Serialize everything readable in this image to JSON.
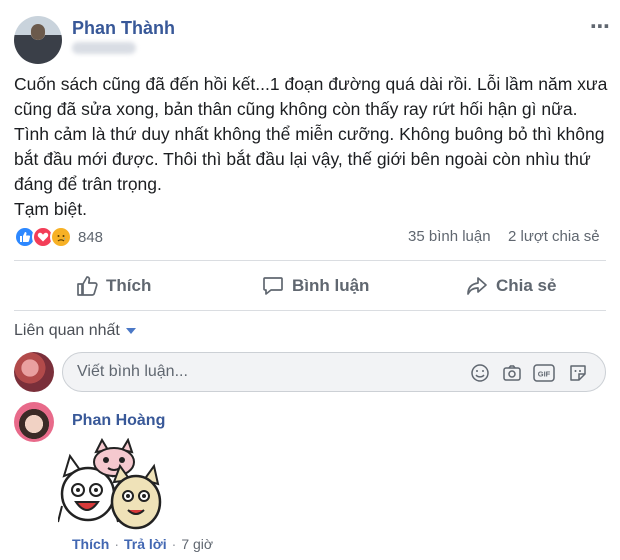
{
  "post": {
    "author": "Phan Thành",
    "text": "Cuốn sách cũng đã đến hồi kết...1 đoạn đường quá dài rồi. Lỗi lầm năm xưa cũng đã sửa xong, bản thân cũng không còn thấy ray rứt hối hận gì nữa. Tình cảm là thứ duy nhất không thể miễn cưỡng. Không buông bỏ thì không bắt đầu mới được. Thôi thì bắt đầu lại vậy, thế giới bên ngoài còn nhìu thứ đáng để trân trọng.\nTạm biệt.",
    "reaction_count": "848",
    "comments_count": "35 bình luận",
    "shares_count": "2 lượt chia sẻ",
    "reactions": [
      "like-icon",
      "love-icon",
      "sad-icon"
    ],
    "colors": {
      "link": "#385898",
      "like": "#2d88ff",
      "love": "#f33e58",
      "sad": "#f7b125"
    }
  },
  "actions": {
    "like": "Thích",
    "comment": "Bình luận",
    "share": "Chia sẻ"
  },
  "comments": {
    "sort_label": "Liên quan nhất",
    "input_placeholder": "Viết bình luận...",
    "input_icons": [
      "emoji-icon",
      "camera-icon",
      "gif-icon",
      "sticker-icon"
    ],
    "gif_label": "GIF",
    "items": [
      {
        "author": "Phan Hoàng",
        "like_label": "Thích",
        "reply_label": "Trả lời",
        "time": "7 giờ"
      }
    ]
  }
}
